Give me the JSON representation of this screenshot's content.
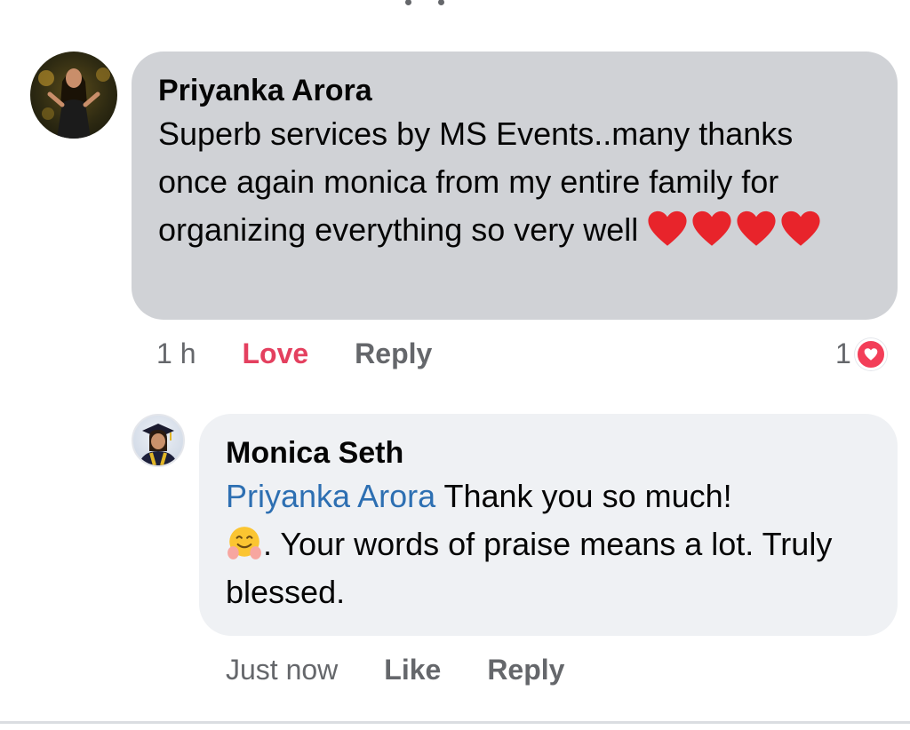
{
  "colors": {
    "comment_bubble": "#d0d2d6",
    "reply_bubble": "#eff1f4",
    "mention": "#2d6fb2",
    "love": "#e4405f",
    "secondary_text": "#65676b"
  },
  "comment": {
    "author": "Priyanka Arora",
    "text": "Superb services by MS Events..many thanks once again monica from my entire family for organizing everything so very well",
    "emoji_icons": [
      "heart-icon",
      "heart-icon",
      "heart-icon",
      "heart-icon"
    ],
    "timestamp": "1 h",
    "love_label": "Love",
    "reply_label": "Reply",
    "reaction_count": "1",
    "reaction_icon": "love-reaction-icon"
  },
  "reply": {
    "author": "Monica Seth",
    "mention": "Priyanka Arora",
    "text_part1": " Thank you so much!",
    "emoji_icon": "hugging-face-icon",
    "text_part2": ". Your words of praise means a lot. Truly blessed.",
    "timestamp": "Just now",
    "like_label": "Like",
    "reply_label": "Reply"
  }
}
